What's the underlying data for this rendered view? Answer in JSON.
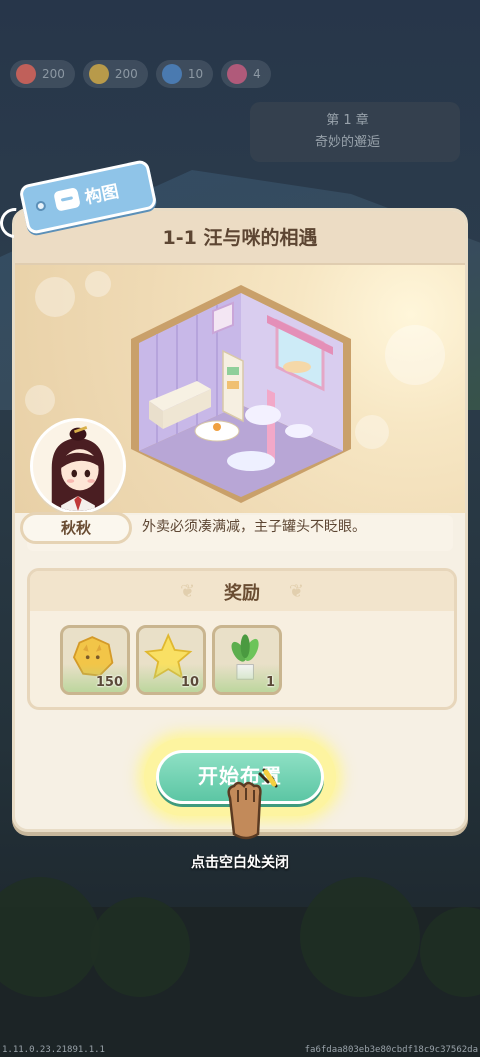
{
  "hud": {
    "coins": "200",
    "cat_coins": "200",
    "gems": "10",
    "hearts": "4"
  },
  "bg_panel": {
    "line1": "第 1 章",
    "line2": "奇妙的邂逅"
  },
  "tag": {
    "label": "构图",
    "icon": "picture-icon"
  },
  "level": {
    "title": "1-1 汪与咪的相遇"
  },
  "dialog": {
    "speaker": "秋秋",
    "text": "外卖必须凑满减，主子罐头不眨眼。"
  },
  "rewards": {
    "title": "奖励",
    "items": [
      {
        "icon": "cat-coin-icon",
        "count": "150"
      },
      {
        "icon": "star-icon",
        "count": "10"
      },
      {
        "icon": "potted-plant-icon",
        "count": "1"
      }
    ]
  },
  "start_button": {
    "label": "开始布置"
  },
  "close_hint": "点击空白处关闭",
  "version": "1.11.0.23.21891.1.1",
  "build_hash": "fa6fdaa803eb3e80cbdf18c9c37562da",
  "colors": {
    "start_button": "#5cc6a4",
    "tag": "#8fc4e8",
    "modal_bg": "#f6f0e4",
    "title_text": "#5d4633"
  }
}
